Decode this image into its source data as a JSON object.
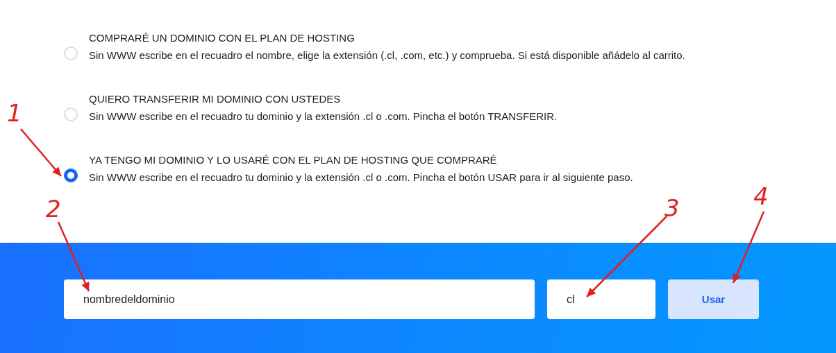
{
  "options": [
    {
      "title": "COMPRARÉ UN DOMINIO CON EL PLAN DE HOSTING",
      "description": "Sin WWW escribe en el recuadro el nombre, elige la extensión (.cl, .com, etc.) y comprueba. Si está disponible añádelo al carrito.",
      "selected": false
    },
    {
      "title": "QUIERO TRANSFERIR MI DOMINIO CON USTEDES",
      "description": "Sin WWW escribe en el recuadro tu dominio y la extensión .cl o .com. Pincha el botón TRANSFERIR.",
      "selected": false
    },
    {
      "title": "YA TENGO MI DOMINIO Y LO USARÉ CON EL PLAN DE HOSTING QUE COMPRARÉ",
      "description": "Sin WWW escribe en el recuadro tu dominio y la extensión .cl o .com. Pincha el botón USAR para ir al siguiente paso.",
      "selected": true
    }
  ],
  "domain_field": {
    "value": "nombredeldominio"
  },
  "extension_field": {
    "value": "cl"
  },
  "use_button": {
    "label": "Usar"
  },
  "annotations": [
    {
      "label": "1"
    },
    {
      "label": "2"
    },
    {
      "label": "3"
    },
    {
      "label": "4"
    }
  ]
}
